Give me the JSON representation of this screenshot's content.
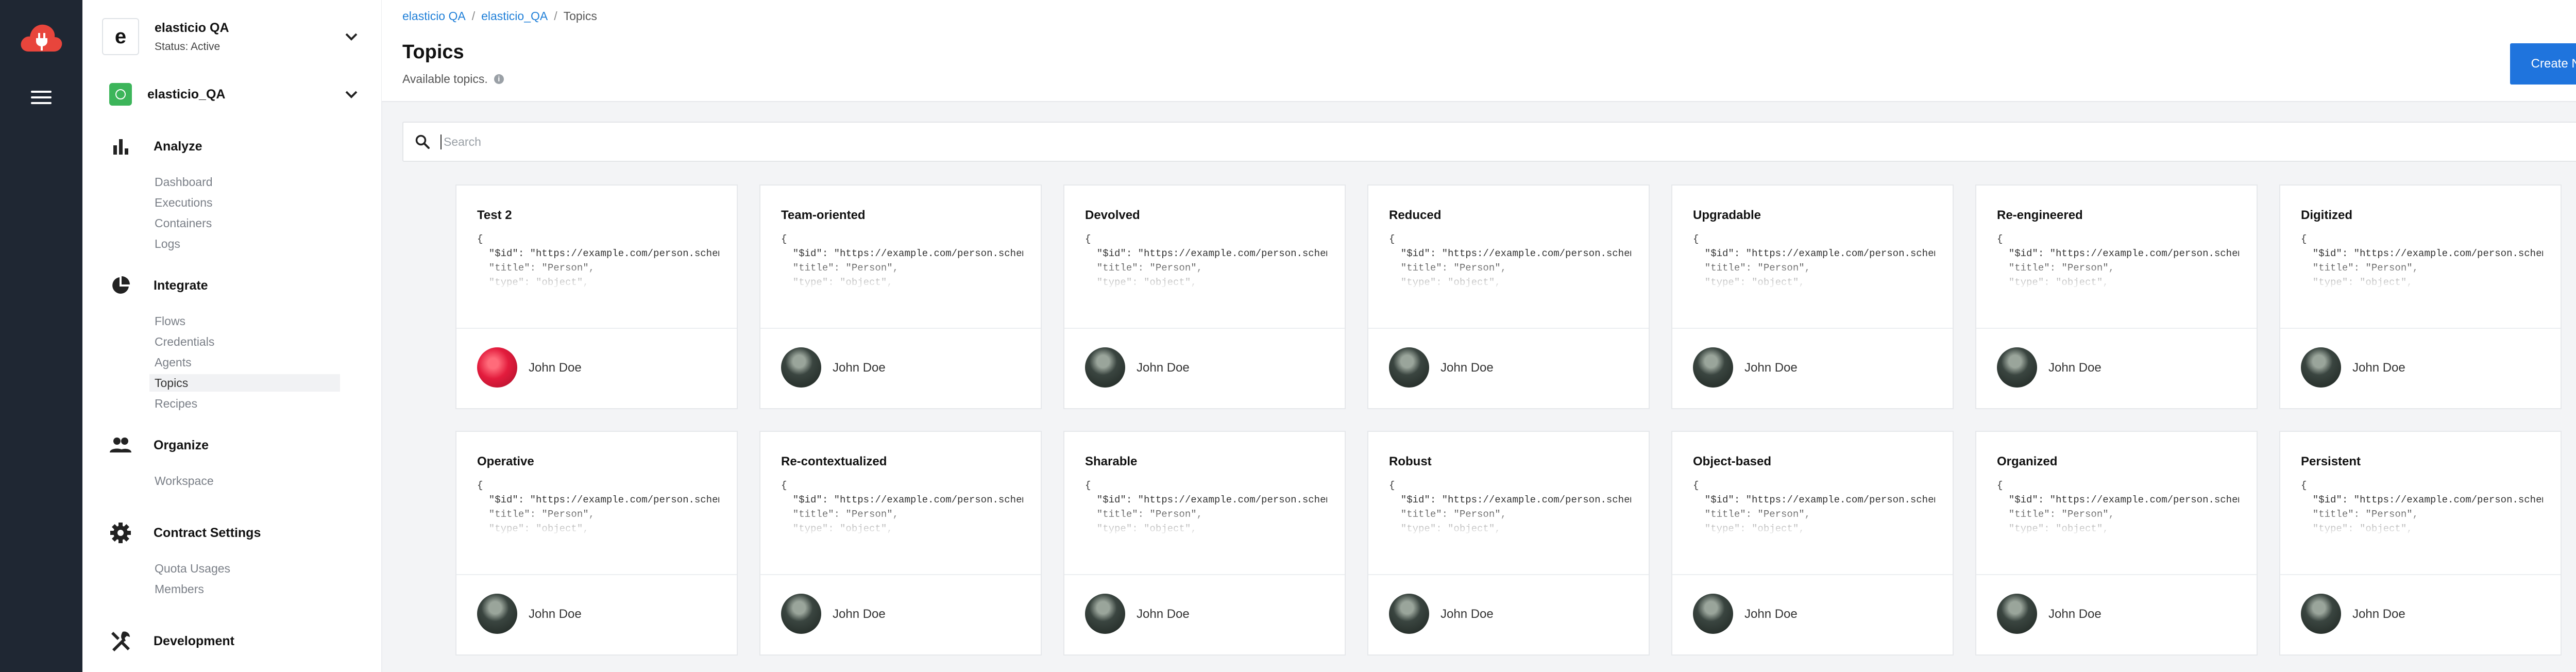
{
  "brand": {
    "logo_icon": "cloud-plug-logo",
    "accent": "#1f74dd",
    "logo_color": "#e8453c"
  },
  "context": {
    "tenant": {
      "initial": "e",
      "name": "elasticio QA",
      "status": "Status: Active"
    },
    "workspace": {
      "name": "elasticio_QA"
    }
  },
  "sections": {
    "analyze": {
      "label": "Analyze",
      "icon": "bar-chart-icon",
      "items": [
        "Dashboard",
        "Executions",
        "Containers",
        "Logs"
      ]
    },
    "integrate": {
      "label": "Integrate",
      "icon": "pie-chart-icon",
      "items": [
        "Flows",
        "Credentials",
        "Agents",
        "Topics",
        "Recipes"
      ]
    },
    "organize": {
      "label": "Organize",
      "icon": "people-icon",
      "items": [
        "Workspace"
      ]
    },
    "contract": {
      "label": "Contract Settings",
      "icon": "gear-icon",
      "items": [
        "Quota Usages",
        "Members"
      ]
    },
    "development": {
      "label": "Development",
      "icon": "tools-icon"
    }
  },
  "active_nav": "Topics",
  "breadcrumb": {
    "items": [
      "elasticio QA",
      "elasticio_QA"
    ],
    "current": "Topics",
    "separator": "/"
  },
  "page": {
    "title": "Topics",
    "subtitle": "Available topics.",
    "create_label": "Create New"
  },
  "search": {
    "placeholder": "Search",
    "value": ""
  },
  "schema_snippet": "{\n  \"$id\": \"https://example.com/person.schema.json\",\n  \"title\": \"Person\",\n  \"type\": \"object\",\n  \"properties\": {\n    \"firstName\": {",
  "topics": [
    {
      "title": "Test 2",
      "owner": "John Doe",
      "avatar": "red"
    },
    {
      "title": "Team-oriented",
      "owner": "John Doe",
      "avatar": "dark"
    },
    {
      "title": "Devolved",
      "owner": "John Doe",
      "avatar": "dark"
    },
    {
      "title": "Reduced",
      "owner": "John Doe",
      "avatar": "dark"
    },
    {
      "title": "Upgradable",
      "owner": "John Doe",
      "avatar": "dark"
    },
    {
      "title": "Re-engineered",
      "owner": "John Doe",
      "avatar": "dark"
    },
    {
      "title": "Digitized",
      "owner": "John Doe",
      "avatar": "dark"
    },
    {
      "title": "Operative",
      "owner": "John Doe",
      "avatar": "dark"
    },
    {
      "title": "Re-contextualized",
      "owner": "John Doe",
      "avatar": "dark"
    },
    {
      "title": "Sharable",
      "owner": "John Doe",
      "avatar": "dark"
    },
    {
      "title": "Robust",
      "owner": "John Doe",
      "avatar": "dark"
    },
    {
      "title": "Object-based",
      "owner": "John Doe",
      "avatar": "dark"
    },
    {
      "title": "Organized",
      "owner": "John Doe",
      "avatar": "dark"
    },
    {
      "title": "Persistent",
      "owner": "John Doe",
      "avatar": "dark"
    }
  ]
}
